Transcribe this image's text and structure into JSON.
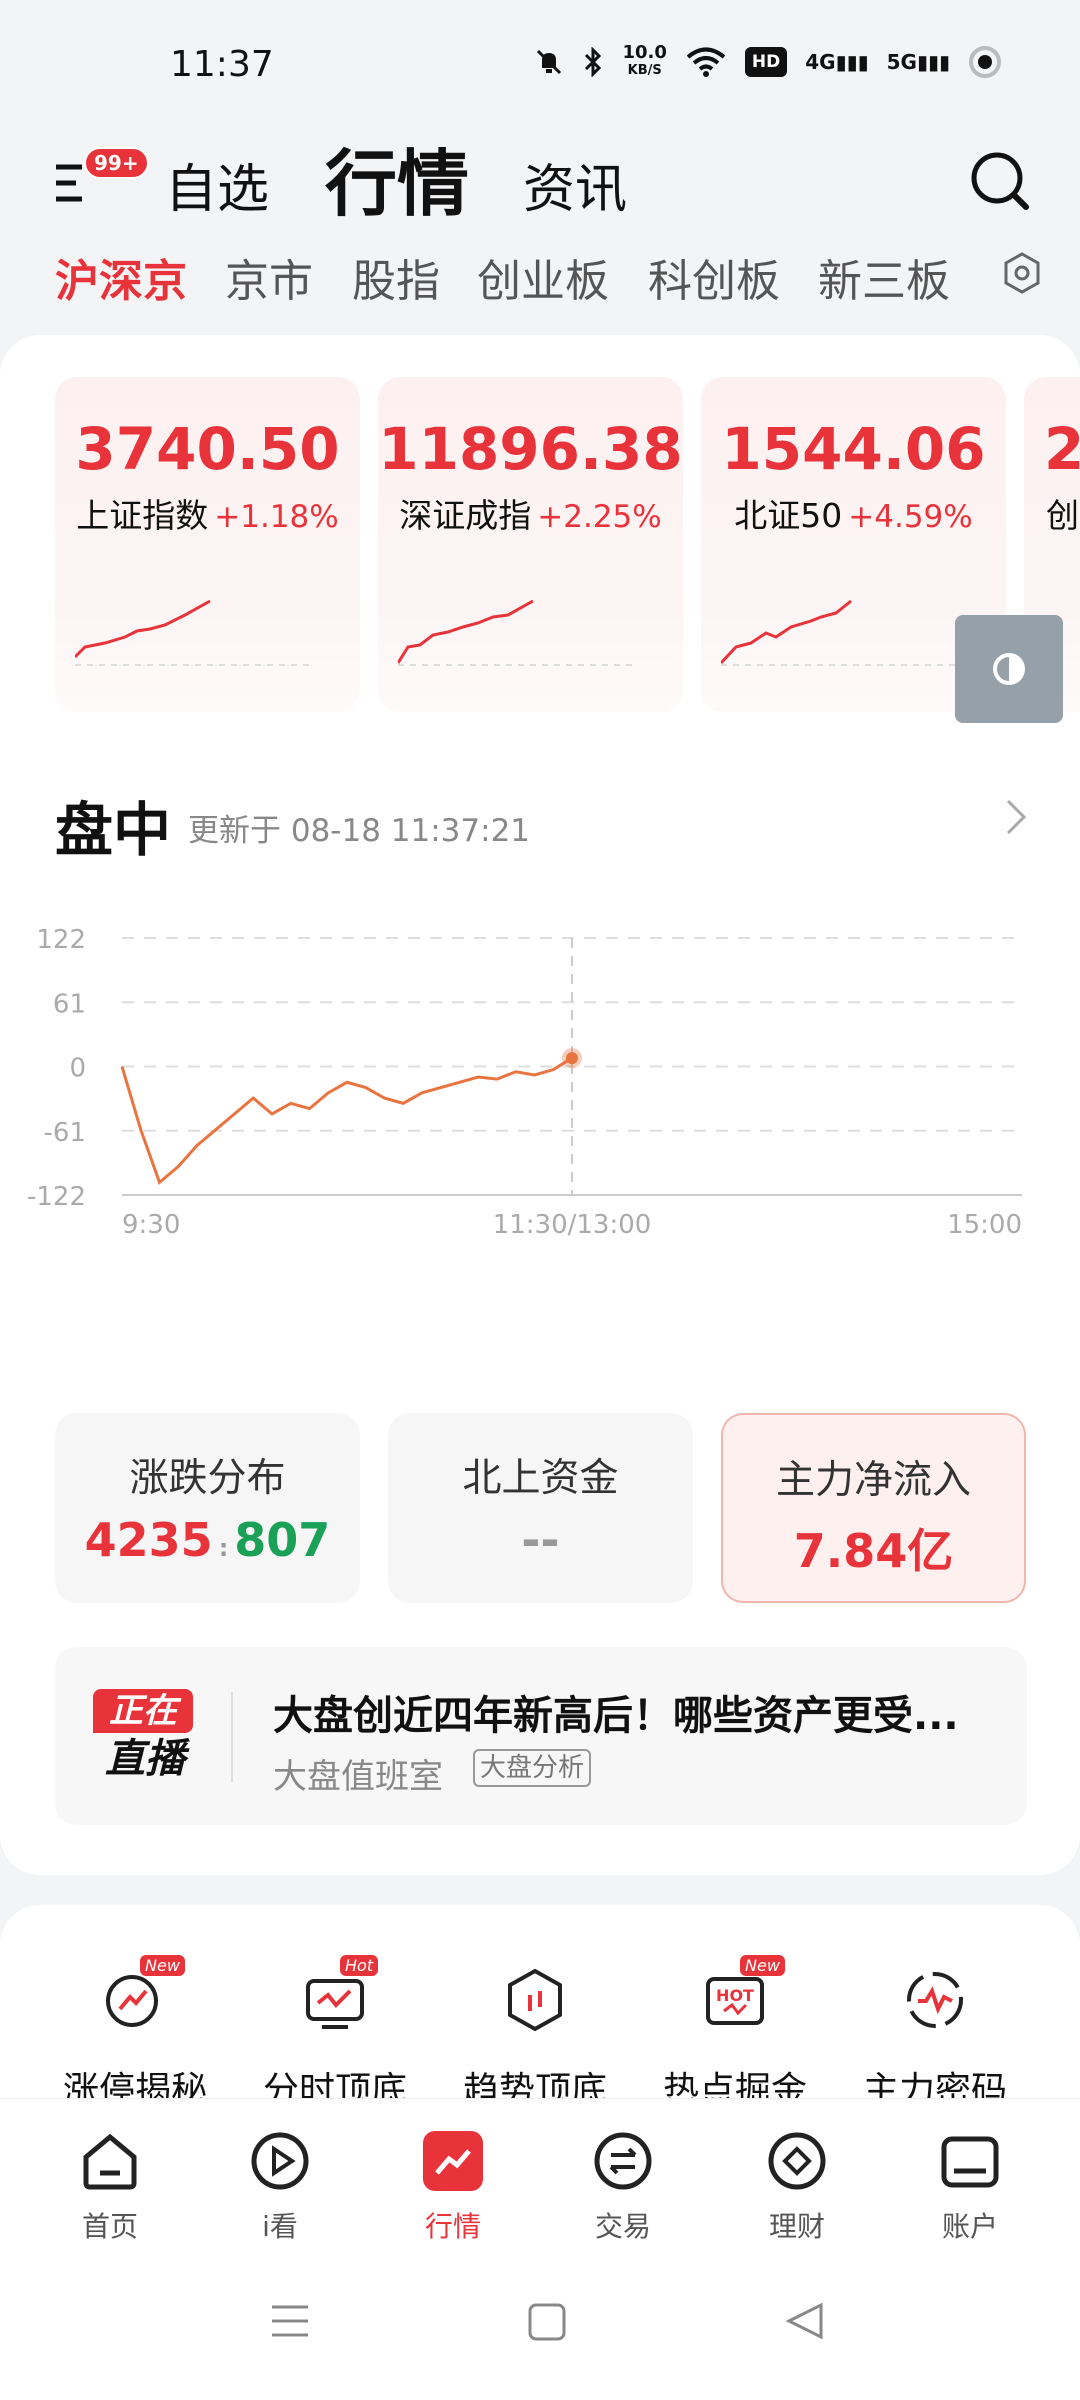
{
  "status_bar": {
    "time": "11:37",
    "net_speed_value": "10.0",
    "net_speed_unit": "KB/S",
    "hd": "HD",
    "signal_1": "4G",
    "signal_2": "5G"
  },
  "header": {
    "badge": "99+",
    "tabs": [
      "自选",
      "行情",
      "资讯"
    ],
    "active_tab": "行情"
  },
  "sub_tabs": [
    "沪深京",
    "京市",
    "股指",
    "创业板",
    "科创板",
    "新三板"
  ],
  "indices": [
    {
      "value": "3740.50",
      "name": "上证指数",
      "change": "+1.18%"
    },
    {
      "value": "11896.38",
      "name": "深证成指",
      "change": "+2.25%"
    },
    {
      "value": "1544.06",
      "name": "北证50",
      "change": "+4.59%"
    },
    {
      "value": "2",
      "name": "创"
    }
  ],
  "market": {
    "title": "盘中",
    "update_time": "更新于 08-18 11:37:21"
  },
  "chart_data": {
    "type": "line",
    "y_ticks": [
      "122",
      "61",
      "0",
      "-61",
      "-122"
    ],
    "ylim": [
      -122,
      122
    ],
    "x_ticks": [
      "9:30",
      "11:30/13:00",
      "15:00"
    ],
    "x": [
      0,
      5,
      10,
      15,
      20,
      25,
      30,
      35,
      40,
      45,
      50,
      55,
      60,
      65,
      70,
      75,
      80,
      85,
      90,
      95,
      100,
      105,
      110,
      115,
      120
    ],
    "values": [
      0,
      -60,
      -110,
      -95,
      -75,
      -60,
      -45,
      -30,
      -45,
      -35,
      -40,
      -25,
      -15,
      -20,
      -30,
      -35,
      -25,
      -20,
      -15,
      -10,
      -12,
      -5,
      -8,
      -3,
      8
    ],
    "line_color": "#e9743f"
  },
  "stats": [
    {
      "title": "涨跌分布",
      "up": "4235",
      "separator": ":",
      "down": "807"
    },
    {
      "title": "北上资金",
      "value": "--"
    },
    {
      "title": "主力净流入",
      "value": "7.84亿"
    }
  ],
  "live": {
    "badge_top": "正在",
    "badge_bottom": "直播",
    "title": "大盘创近四年新高后！哪些资产更受...",
    "source": "大盘值班室",
    "tag": "大盘分析"
  },
  "tools": [
    {
      "label": "涨停揭秘",
      "tag": "New",
      "icon": "rise-limit-icon"
    },
    {
      "label": "分时顶底",
      "tag": "Hot",
      "icon": "timeshare-icon"
    },
    {
      "label": "趋势顶底",
      "tag": "",
      "icon": "trend-icon"
    },
    {
      "label": "热点掘金",
      "tag": "New",
      "icon": "hotspot-icon"
    },
    {
      "label": "主力密码",
      "tag": "",
      "icon": "main-force-icon"
    }
  ],
  "bottom_nav": [
    {
      "label": "首页",
      "icon": "home-icon"
    },
    {
      "label": "i看",
      "icon": "play-icon"
    },
    {
      "label": "行情",
      "icon": "market-icon"
    },
    {
      "label": "交易",
      "icon": "trade-icon"
    },
    {
      "label": "理财",
      "icon": "finance-icon"
    },
    {
      "label": "账户",
      "icon": "account-icon"
    }
  ],
  "active_nav": "行情",
  "colors": {
    "accent": "#e8333a",
    "down": "#1aa057",
    "line": "#e9743f"
  }
}
